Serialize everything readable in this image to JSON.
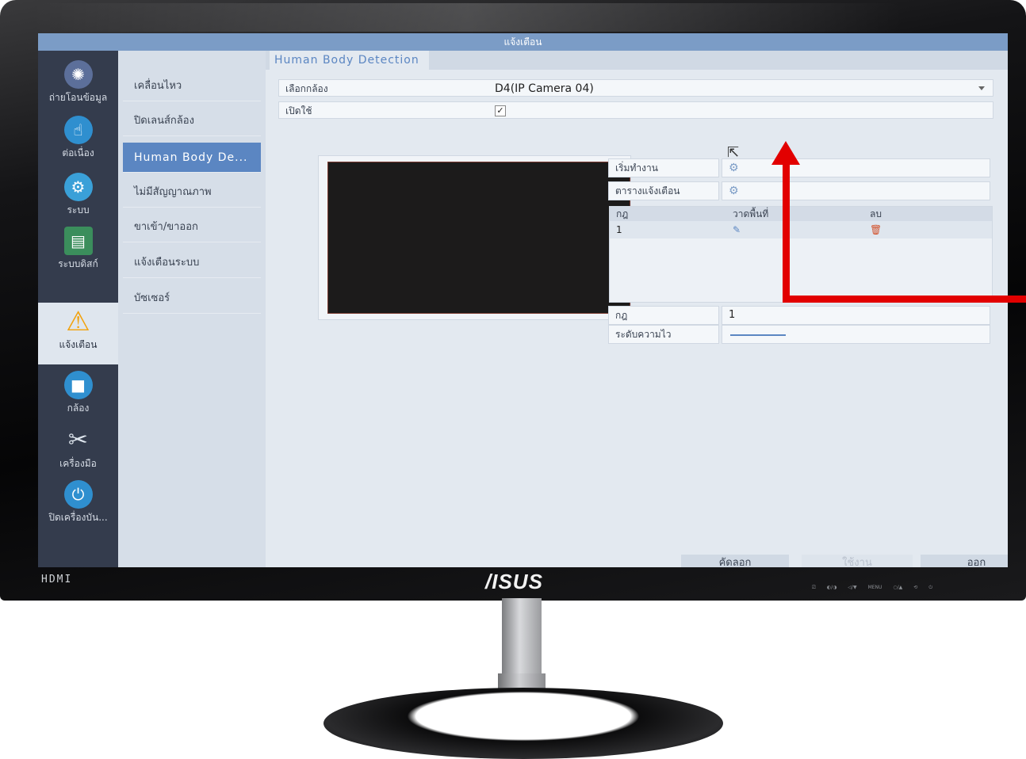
{
  "monitor": {
    "port_label": "HDMI",
    "brand": "/ISUS",
    "controls": [
      "⎚",
      "◐/◑",
      "◁/▼",
      "MENU",
      "○/▲",
      "⟲",
      "⏻"
    ]
  },
  "window": {
    "title": "แจ้งเตือน"
  },
  "left_nav": [
    {
      "label": "ถ่ายโอนข้อมูล",
      "icon": "film-reel-icon",
      "glyph": "✺",
      "color": "#5c6f9a"
    },
    {
      "label": "ต่อเนื่อง",
      "icon": "hand-touch-icon",
      "glyph": "☝",
      "color": "#2f8fcf"
    },
    {
      "label": "ระบบ",
      "icon": "gear-icon",
      "glyph": "⚙",
      "color": "#3aa0d8"
    },
    {
      "label": "ระบบดิสก์",
      "icon": "disk-stack-icon",
      "glyph": "▤",
      "color": "#3b8e5c"
    },
    {
      "label": "แจ้งเตือน",
      "icon": "warning-icon",
      "glyph": "⚠",
      "color": "#f2a20c"
    },
    {
      "label": "กล้อง",
      "icon": "camera-icon",
      "glyph": "■",
      "color": "#2f8fcf"
    },
    {
      "label": "เครื่องมือ",
      "icon": "tools-icon",
      "glyph": "✂",
      "color": "#3aa0d8"
    },
    {
      "label": "ปิดเครื่องบัน...",
      "icon": "power-icon",
      "glyph": "⏻",
      "color": "#2f8fcf"
    }
  ],
  "sub_menu": [
    {
      "label": "เคลื่อนไหว"
    },
    {
      "label": "ปิดเลนส์กล้อง"
    },
    {
      "label": "Human Body De..."
    },
    {
      "label": "ไม่มีสัญญาณภาพ"
    },
    {
      "label": "ขาเข้า/ขาออก"
    },
    {
      "label": "แจ้งเตือนระบบ"
    },
    {
      "label": "บัซเซอร์"
    }
  ],
  "tab": {
    "label": "Human Body Detection"
  },
  "form": {
    "camera_label": "เลือกกล้อง",
    "camera_value": "D4(IP Camera 04)",
    "enable_label": "เปิดใช้",
    "enable_check": "✓",
    "start_label": "เริ่มทำงาน",
    "schedule_label": "ตารางแจ้งเตือน",
    "rule_label": "กฎ",
    "rule_value": "1",
    "sensitivity_label": "ระดับความไว"
  },
  "rules_table": {
    "headers": [
      "กฎ",
      "วาดพื้นที่",
      "ลบ"
    ],
    "rows": [
      {
        "rule": "1",
        "draw_icon": "✎",
        "delete_icon": "🗑"
      }
    ]
  },
  "buttons": {
    "copy": "คัดลอก",
    "apply": "ใช้งาน",
    "exit": "ออก"
  },
  "annotation": {
    "arrow_color": "#e20000"
  }
}
